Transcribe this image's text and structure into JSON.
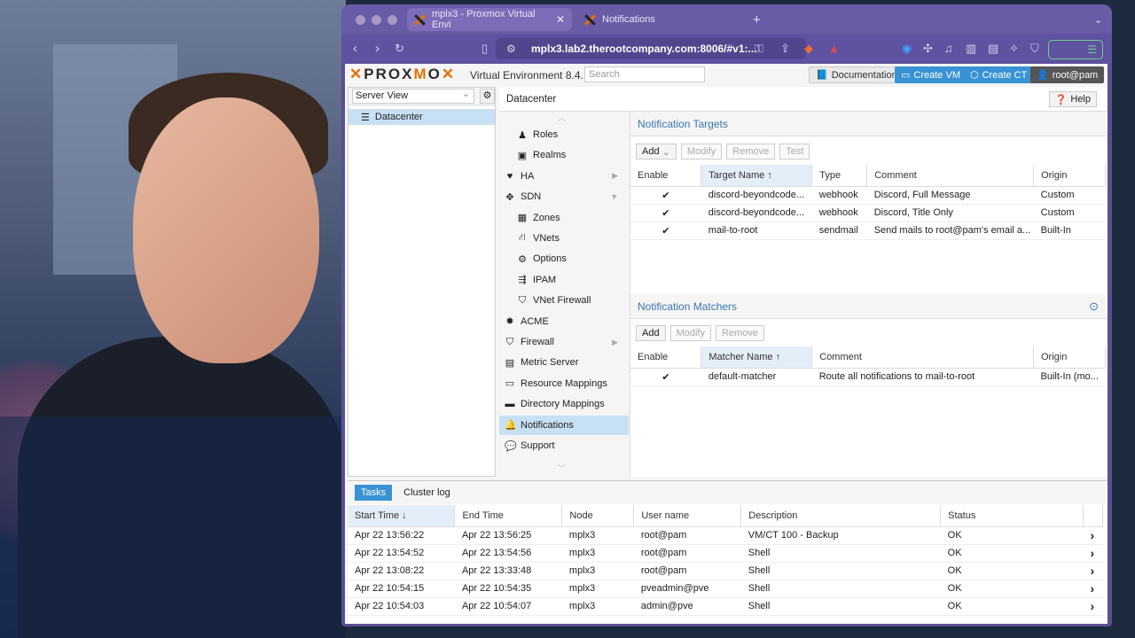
{
  "browser": {
    "tabs": [
      {
        "label": "mplx3 - Proxmox Virtual Envi",
        "active": true
      },
      {
        "label": "Notifications",
        "active": false
      }
    ],
    "url": "mplx3.lab2.therootcompany.com:8006/#v1:..."
  },
  "pve": {
    "product": "Virtual Environment 8.4.1",
    "search_placeholder": "Search",
    "buttons": {
      "documentation": "Documentation",
      "create_vm": "Create VM",
      "create_ct": "Create CT",
      "user": "root@pam"
    },
    "tree": {
      "view": "Server View",
      "root": "Datacenter"
    },
    "breadcrumb": "Datacenter",
    "help": "Help",
    "menu": [
      {
        "label": "Roles",
        "icon": "person-icon",
        "indent": true
      },
      {
        "label": "Realms",
        "icon": "address-book-icon",
        "indent": true
      },
      {
        "label": "HA",
        "icon": "heartbeat-icon",
        "indent": false,
        "arrow": "right"
      },
      {
        "label": "SDN",
        "icon": "sdn-icon",
        "indent": false,
        "arrow": "down"
      },
      {
        "label": "Zones",
        "icon": "grid-icon",
        "indent": true
      },
      {
        "label": "VNets",
        "icon": "network-icon",
        "indent": true
      },
      {
        "label": "Options",
        "icon": "gear-icon",
        "indent": true
      },
      {
        "label": "IPAM",
        "icon": "signpost-icon",
        "indent": true
      },
      {
        "label": "VNet Firewall",
        "icon": "shield-icon",
        "indent": true
      },
      {
        "label": "ACME",
        "icon": "certificate-icon",
        "indent": false
      },
      {
        "label": "Firewall",
        "icon": "shield-icon",
        "indent": false,
        "arrow": "right"
      },
      {
        "label": "Metric Server",
        "icon": "bar-chart-icon",
        "indent": false
      },
      {
        "label": "Resource Mappings",
        "icon": "folder-icon",
        "indent": false
      },
      {
        "label": "Directory Mappings",
        "icon": "folder-solid-icon",
        "indent": false
      },
      {
        "label": "Notifications",
        "icon": "bell-icon",
        "indent": false,
        "selected": true
      },
      {
        "label": "Support",
        "icon": "comments-icon",
        "indent": false
      }
    ],
    "targets": {
      "title": "Notification Targets",
      "toolbar": [
        "Add",
        "Modify",
        "Remove",
        "Test"
      ],
      "columns": [
        "Enable",
        "Target Name ↑",
        "Type",
        "Comment",
        "Origin"
      ],
      "rows": [
        {
          "enable": "✔",
          "name": "discord-beyondcode...",
          "type": "webhook",
          "comment": "Discord, Full Message",
          "origin": "Custom"
        },
        {
          "enable": "✔",
          "name": "discord-beyondcode...",
          "type": "webhook",
          "comment": "Discord, Title Only",
          "origin": "Custom"
        },
        {
          "enable": "✔",
          "name": "mail-to-root",
          "type": "sendmail",
          "comment": "Send mails to root@pam's email a...",
          "origin": "Built-In"
        }
      ]
    },
    "matchers": {
      "title": "Notification Matchers",
      "toolbar": [
        "Add",
        "Modify",
        "Remove"
      ],
      "columns": [
        "Enable",
        "Matcher Name ↑",
        "Comment",
        "Origin"
      ],
      "rows": [
        {
          "enable": "✔",
          "name": "default-matcher",
          "comment": "Route all notifications to mail-to-root",
          "origin": "Built-In (mo..."
        }
      ]
    },
    "tasks": {
      "tabs": [
        "Tasks",
        "Cluster log"
      ],
      "columns": [
        "Start Time ↓",
        "End Time",
        "Node",
        "User name",
        "Description",
        "Status"
      ],
      "rows": [
        {
          "start": "Apr 22 13:56:22",
          "end": "Apr 22 13:56:25",
          "node": "mplx3",
          "user": "root@pam",
          "desc": "VM/CT 100 - Backup",
          "status": "OK"
        },
        {
          "start": "Apr 22 13:54:52",
          "end": "Apr 22 13:54:56",
          "node": "mplx3",
          "user": "root@pam",
          "desc": "Shell",
          "status": "OK"
        },
        {
          "start": "Apr 22 13:08:22",
          "end": "Apr 22 13:33:48",
          "node": "mplx3",
          "user": "root@pam",
          "desc": "Shell",
          "status": "OK"
        },
        {
          "start": "Apr 22 10:54:15",
          "end": "Apr 22 10:54:35",
          "node": "mplx3",
          "user": "pveadmin@pve",
          "desc": "Shell",
          "status": "OK"
        },
        {
          "start": "Apr 22 10:54:03",
          "end": "Apr 22 10:54:07",
          "node": "mplx3",
          "user": "admin@pve",
          "desc": "Shell",
          "status": "OK"
        }
      ]
    }
  }
}
